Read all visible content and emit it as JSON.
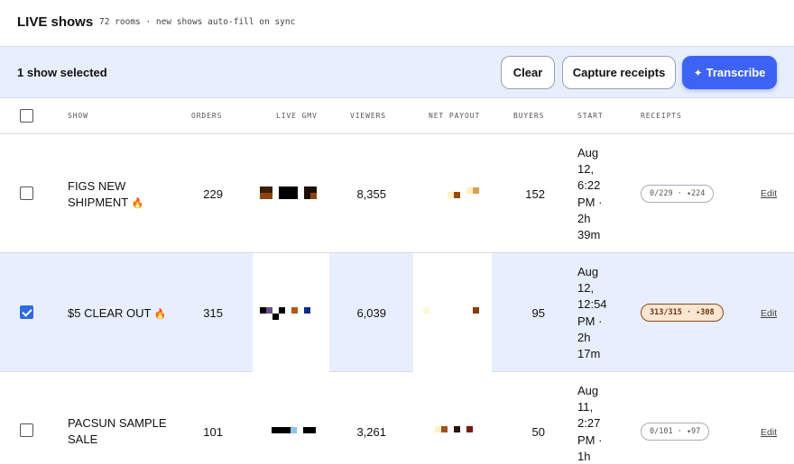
{
  "header": {
    "title": "LIVE shows",
    "subtitle": "72 rooms · new shows auto-fill on sync"
  },
  "selection_bar": {
    "count_label": "1 show selected",
    "clear_label": "Clear",
    "capture_label": "Capture receipts",
    "transcribe_icon": "✦",
    "transcribe_label": "Transcribe"
  },
  "columns": {
    "show": "SHOW",
    "orders": "ORDERS",
    "live_gmv": "LIVE GMV",
    "viewers": "VIEWERS",
    "net_payout": "NET PAYOUT",
    "buyers": "BUYERS",
    "start": "START",
    "receipts": "RECEIPTS"
  },
  "rows": [
    {
      "selected": false,
      "show_name": "FIGS NEW SHIPMENT",
      "flame": "🔥",
      "orders": "229",
      "viewers": "8,355",
      "buyers": "152",
      "start_lines": [
        "Aug",
        "12,",
        "6:22",
        "PM ·",
        "2h",
        "39m"
      ],
      "receipts": "0/229 · ✦224",
      "edit_label": "Edit"
    },
    {
      "selected": true,
      "show_name": "$5 CLEAR OUT",
      "flame": "🔥",
      "orders": "315",
      "viewers": "6,039",
      "buyers": "95",
      "start_lines": [
        "Aug",
        "12,",
        "12:54",
        "PM ·",
        "2h",
        "17m"
      ],
      "receipts": "313/315 · ✦308",
      "edit_label": "Edit"
    },
    {
      "selected": false,
      "show_name": "PACSUN SAMPLE SALE",
      "flame": "",
      "orders": "101",
      "viewers": "3,261",
      "buyers": "50",
      "start_lines": [
        "Aug",
        "11,",
        "2:27",
        "PM ·",
        "1h"
      ],
      "receipts": "0/101 · ✦97",
      "edit_label": "Edit"
    }
  ],
  "colors": {
    "accent": "#3d63f5",
    "selected_row": "#e7eefe",
    "checkbox_checked": "#2f6ae0",
    "badge_warm_bg": "#fbe6d2",
    "badge_warm_border": "#8a4a1c"
  }
}
